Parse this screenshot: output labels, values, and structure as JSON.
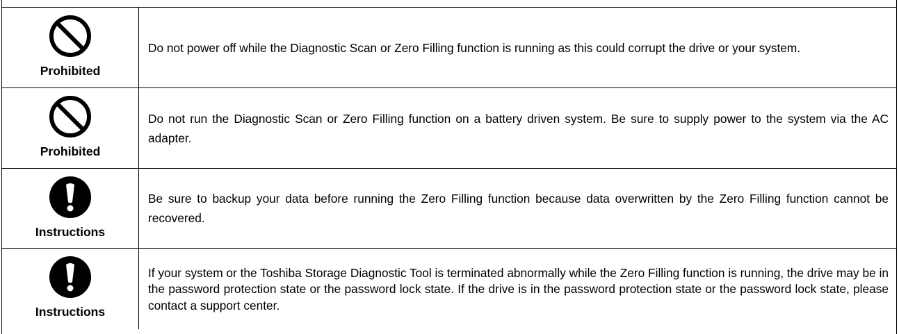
{
  "rows": [
    {
      "icon": "prohibited-icon",
      "label": "Prohibited",
      "text": "Do not power off while the Diagnostic Scan or Zero Filling function is running as this could corrupt the drive or your system."
    },
    {
      "icon": "prohibited-icon",
      "label": "Prohibited",
      "text": "Do not run the Diagnostic Scan or Zero Filling function on a battery driven system. Be sure to supply power to the system via the AC adapter."
    },
    {
      "icon": "exclamation-icon",
      "label": "Instructions",
      "text": "Be sure to backup your data before running the Zero Filling function because data overwritten by the Zero Filling function cannot be recovered."
    },
    {
      "icon": "exclamation-icon",
      "label": "Instructions",
      "text": "If your system or the Toshiba Storage Diagnostic Tool is terminated abnormally while the Zero Filling function is running, the drive may be in the password protection state or the password lock state. If the drive is in the password protection state or the password lock state, please contact a support center."
    }
  ]
}
